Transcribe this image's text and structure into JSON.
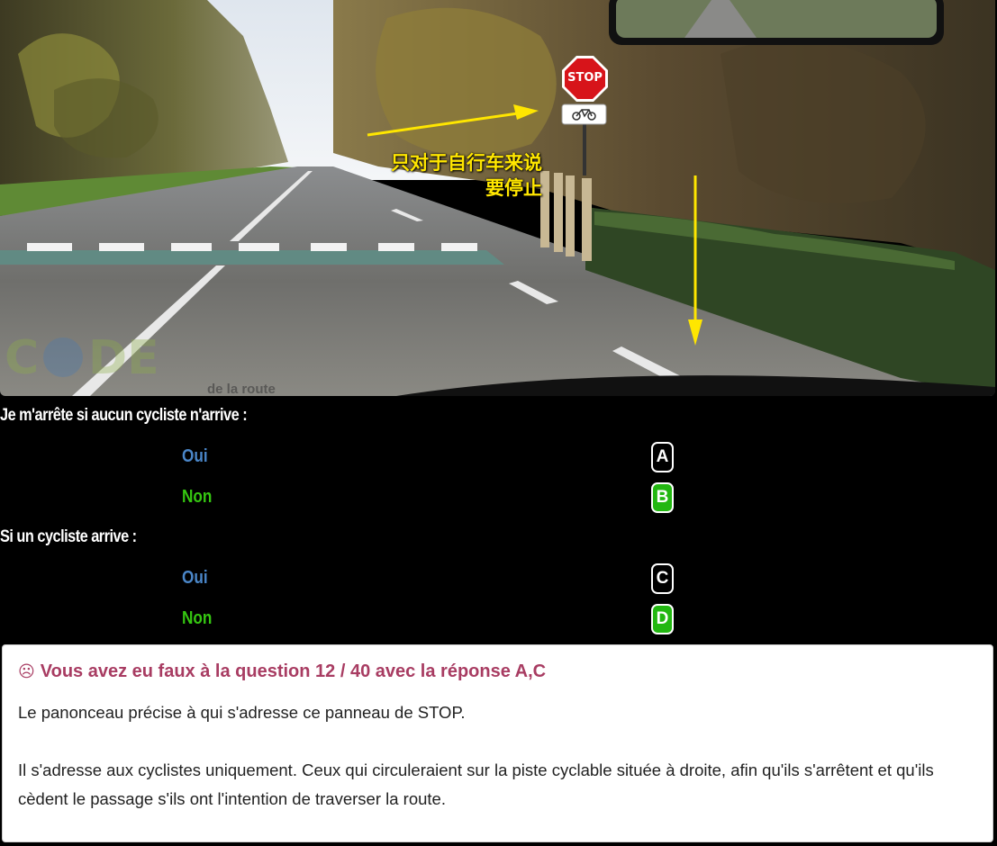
{
  "scene": {
    "sign_text": "STOP",
    "annotation_line1": "只对于自行车来说",
    "annotation_line2": "要停止",
    "watermark": "de la route"
  },
  "question1": {
    "text": "Je m'arrête si aucun cycliste n'arrive :",
    "options": [
      {
        "label": "Oui",
        "key": "A",
        "selected": false
      },
      {
        "label": "Non",
        "key": "B",
        "selected": true
      }
    ]
  },
  "question2": {
    "text": "Si un cycliste arrive :",
    "options": [
      {
        "label": "Oui",
        "key": "C",
        "selected": false
      },
      {
        "label": "Non",
        "key": "D",
        "selected": true
      }
    ]
  },
  "feedback": {
    "icon": "☹",
    "title": "Vous avez eu faux à la question 12 / 40 avec la réponse A,C",
    "paragraph1": "Le panonceau précise à qui s'adresse ce panneau de STOP.",
    "paragraph2": "Il s'adresse aux cyclistes uniquement. Ceux qui circuleraient sur la piste cyclable située à droite, afin qu'ils s'arrêtent et qu'ils cèdent le passage s'ils ont l'intention de traverser la route."
  },
  "colors": {
    "oui": "#4a86c8",
    "non": "#35c611",
    "selected_key": "#22b711",
    "feedback_title": "#a83c62",
    "annotation": "#ffe600"
  }
}
